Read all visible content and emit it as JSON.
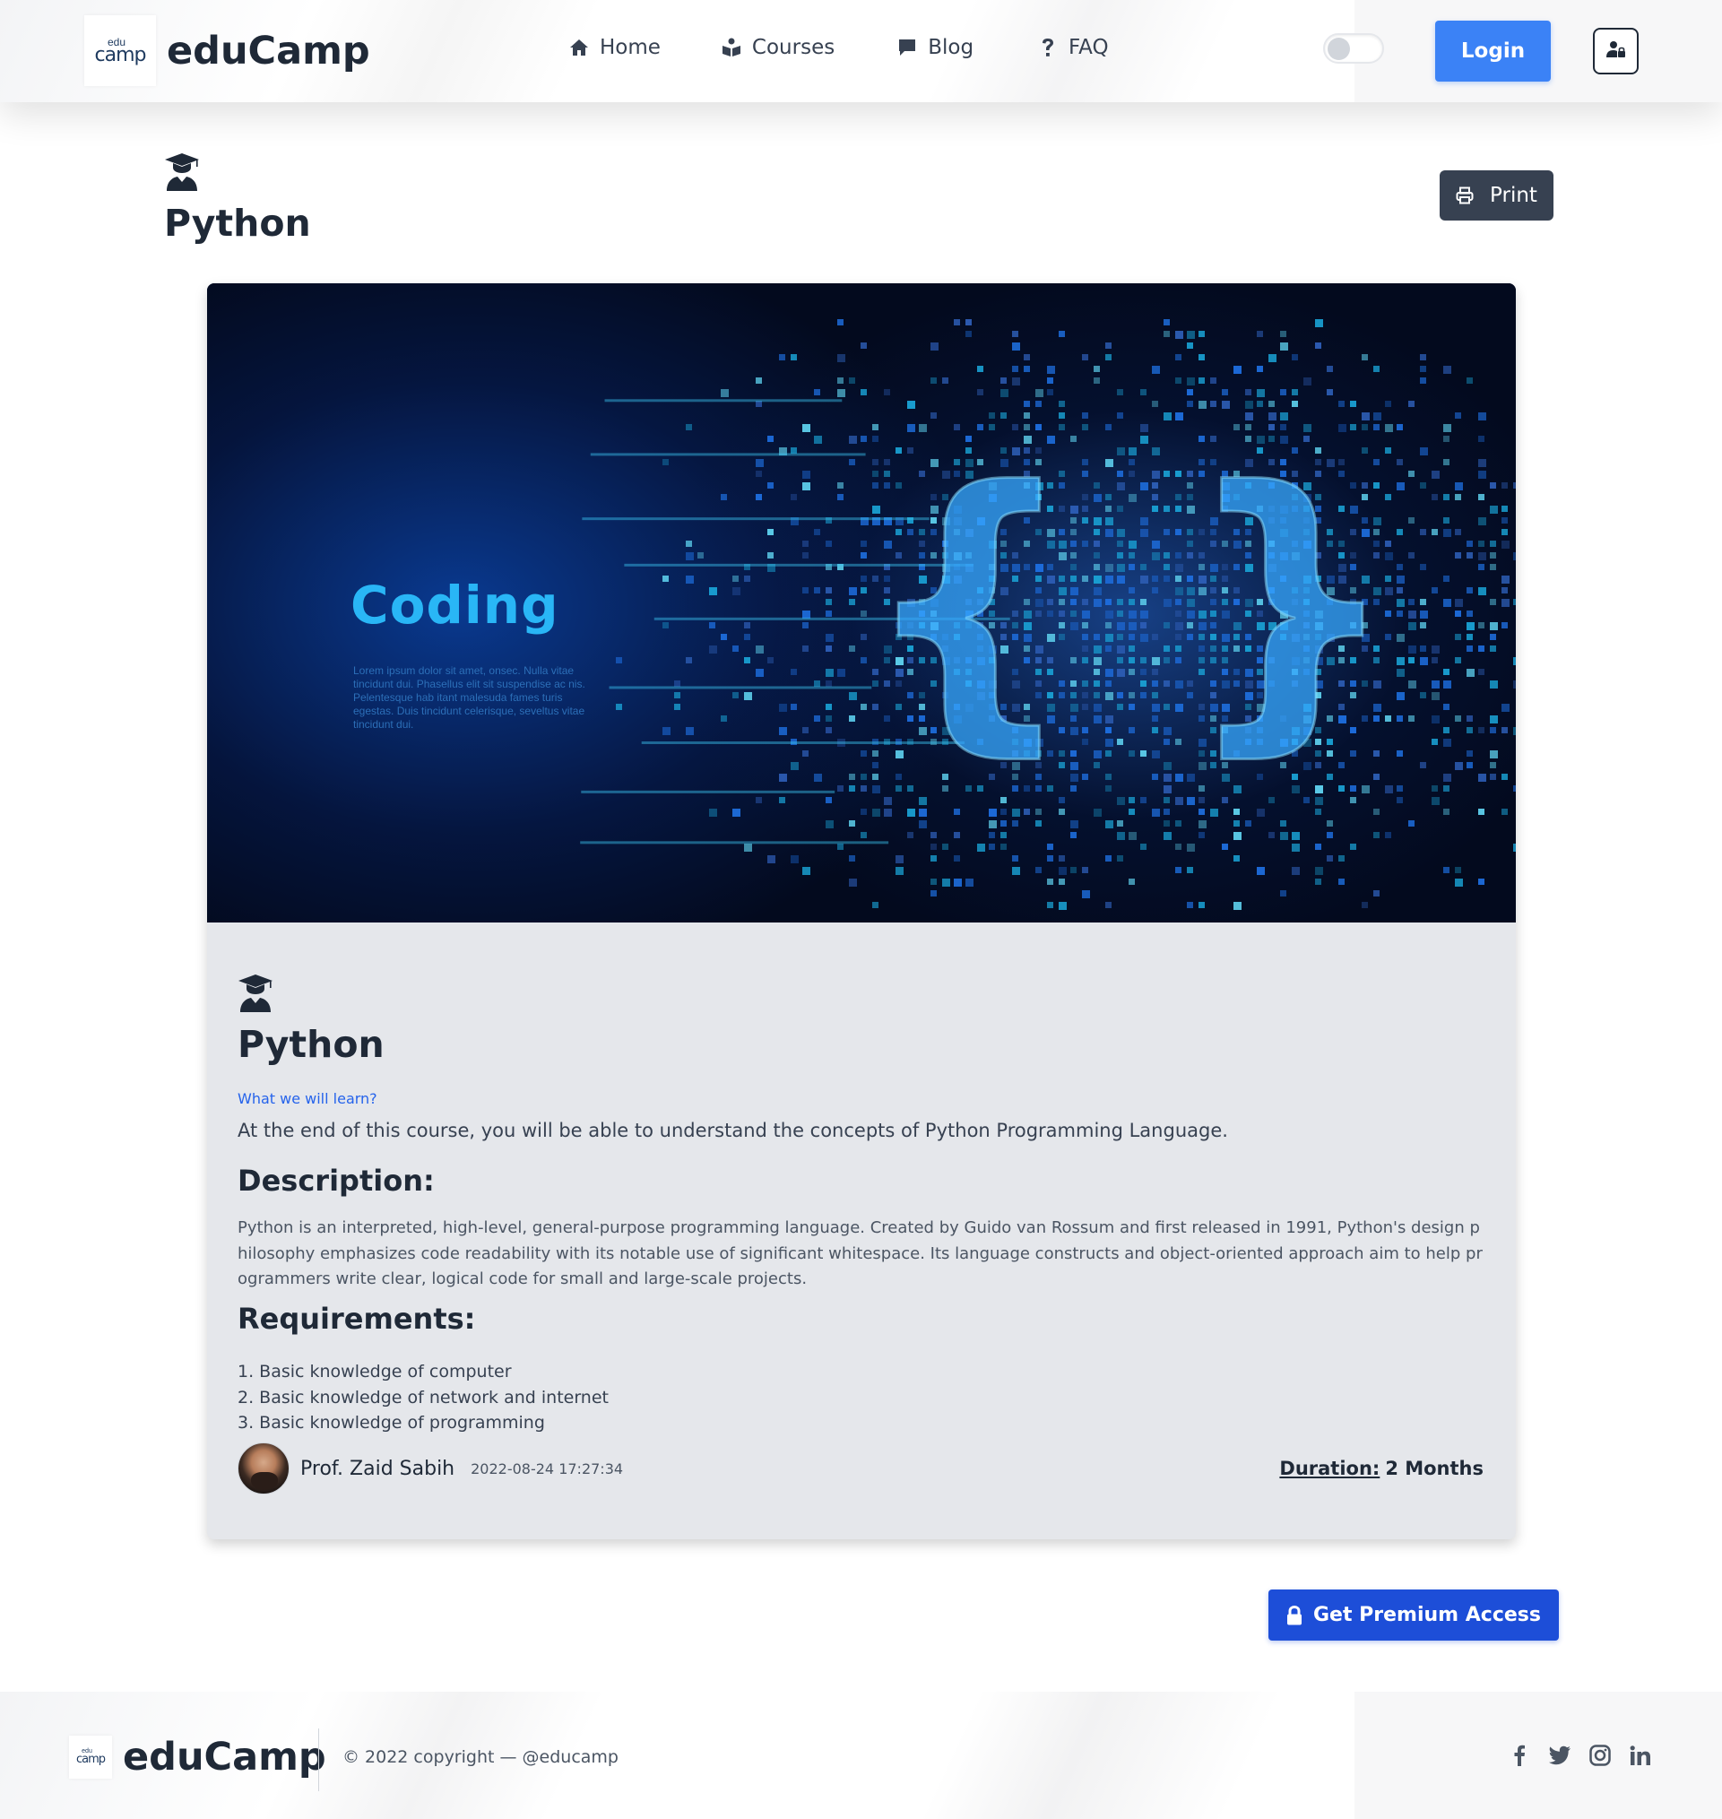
{
  "brand": {
    "logo_edu": "edu",
    "logo_camp": "camp",
    "name": "eduCamp"
  },
  "nav": [
    {
      "label": "Home",
      "icon": "home-icon"
    },
    {
      "label": "Courses",
      "icon": "courses-icon"
    },
    {
      "label": "Blog",
      "icon": "comment-icon"
    },
    {
      "label": "FAQ",
      "icon": "question-icon"
    }
  ],
  "header": {
    "login_label": "Login",
    "theme_toggle": "off",
    "user_icon": "user-lock-icon"
  },
  "page": {
    "title": "Python",
    "print_label": "Print",
    "title_icon": "graduate-icon"
  },
  "hero": {
    "word": "Coding",
    "lorem": "Lorem ipsum dolor sit amet, onsec. Nulla vitae tincidunt dui. Phasellus elit sit suspendise ac nis. Pelentesque hab itant malesuda fames turis egestas. Duis tincidunt celerisque, seveltus vitae tincidunt dui.",
    "braces": "{ }"
  },
  "course": {
    "title": "Python",
    "learn_label": "What we will learn?",
    "learn_text": "At the end of this course, you will be able to understand the concepts of Python Programming Language.",
    "description_heading": "Description:",
    "description": "Python is an interpreted, high-level, general-purpose programming language. Created by Guido van Rossum and first released in 1991, Python's design philosophy emphasizes code readability with its notable use of significant whitespace. Its language constructs and object-oriented approach aim to help programmers write clear, logical code for small and large-scale projects.",
    "requirements_heading": "Requirements:",
    "requirements": [
      "1. Basic knowledge of computer",
      "2. Basic knowledge of network and internet",
      "3. Basic knowledge of programming"
    ],
    "author": "Prof. Zaid Sabih",
    "date": "2022-08-24 17:27:34",
    "duration_label": "Duration:",
    "duration_value": "2 Months"
  },
  "premium": {
    "label": "Get Premium Access",
    "icon": "lock-icon"
  },
  "footer": {
    "copyright": "© 2022 copyright — @educamp",
    "social": [
      "facebook-icon",
      "twitter-icon",
      "instagram-icon",
      "linkedin-icon"
    ]
  },
  "colors": {
    "primary": "#3b82f6",
    "premium": "#1d4ed8",
    "dark": "#374151",
    "card": "#e5e7eb",
    "link": "#2563eb"
  }
}
